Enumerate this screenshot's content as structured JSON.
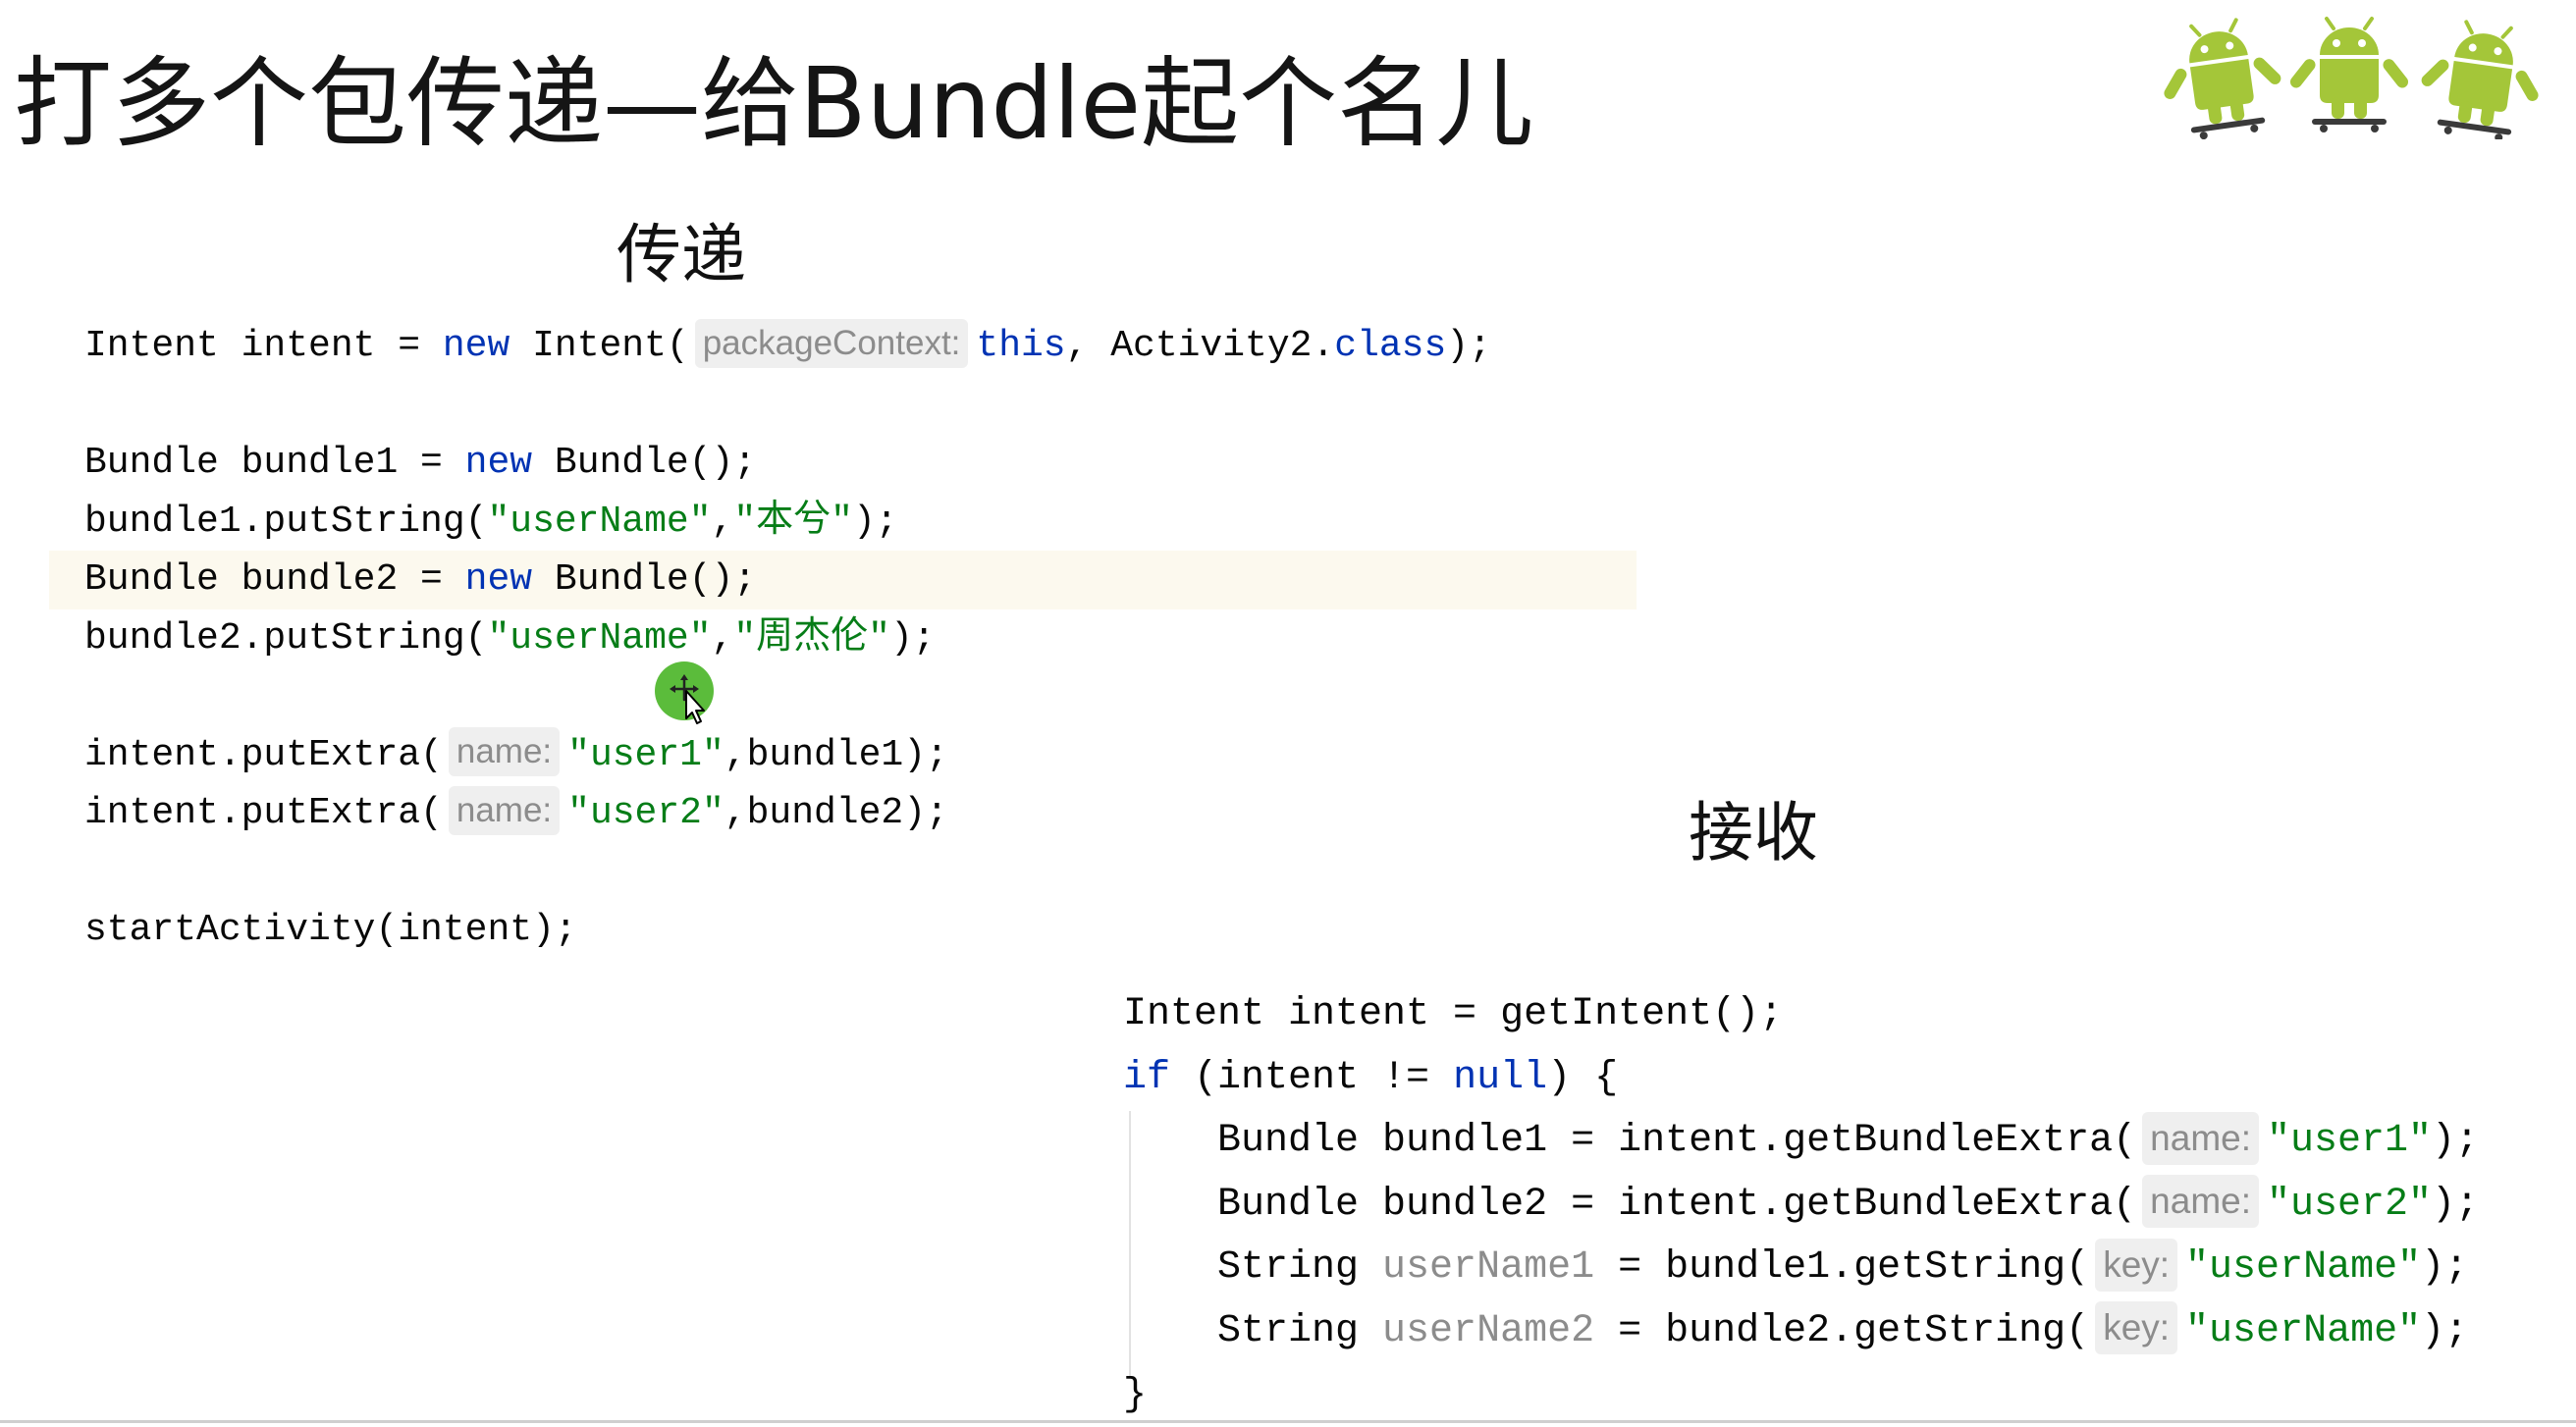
{
  "title": "打多个包传递—给Bundle起个名儿",
  "colors": {
    "text": "#080808",
    "keyword": "#0033b3",
    "string": "#067d17",
    "hint_text": "#8c8c8c",
    "hint_background": "#efefef",
    "unused_variable": "#8c8c8c",
    "current_line": "#fcf9ee",
    "android_green": "#a4c639",
    "cursor_ring": "#52b830"
  },
  "icons": {
    "logo": "android-skateboard-robots-icon",
    "cursor": "move-cursor-icon"
  },
  "send": {
    "heading": "传递",
    "current_line": 4,
    "lines": [
      [
        {
          "plain": "Intent intent = "
        },
        {
          "keyword": "new"
        },
        {
          "plain": " Intent("
        },
        {
          "hint": "packageContext:"
        },
        {
          "keyword": "this"
        },
        {
          "plain": ", Activity2."
        },
        {
          "keyword": "class"
        },
        {
          "plain": ");"
        }
      ],
      [],
      [
        {
          "plain": "Bundle bundle1 = "
        },
        {
          "keyword": "new"
        },
        {
          "plain": " Bundle();"
        }
      ],
      [
        {
          "plain": "bundle1.putString("
        },
        {
          "string": "\"userName\""
        },
        {
          "plain": ","
        },
        {
          "string": "\"本兮\""
        },
        {
          "plain": ");"
        }
      ],
      [
        {
          "plain": "Bundle bundle2 = "
        },
        {
          "keyword": "new"
        },
        {
          "plain": " Bundle();"
        }
      ],
      [
        {
          "plain": "bundle2.putString("
        },
        {
          "string": "\"userName\""
        },
        {
          "plain": ","
        },
        {
          "string": "\"周杰伦\""
        },
        {
          "plain": ");"
        }
      ],
      [],
      [
        {
          "plain": "intent.putExtra("
        },
        {
          "hint": "name:"
        },
        {
          "string": "\"user1\""
        },
        {
          "plain": ",bundle1);"
        }
      ],
      [
        {
          "plain": "intent.putExtra("
        },
        {
          "hint": "name:"
        },
        {
          "string": "\"user2\""
        },
        {
          "plain": ",bundle2);"
        }
      ],
      [],
      [
        {
          "plain": "startActivity(intent);"
        }
      ]
    ]
  },
  "receive": {
    "heading": "接收",
    "lines": [
      [
        {
          "plain": "Intent intent = getIntent();"
        }
      ],
      [
        {
          "keyword": "if"
        },
        {
          "plain": " (intent != "
        },
        {
          "keyword": "null"
        },
        {
          "plain": ") {"
        }
      ],
      [
        {
          "plain": "    Bundle bundle1 = intent.getBundleExtra("
        },
        {
          "hint": "name:"
        },
        {
          "string": "\"user1\""
        },
        {
          "plain": ");"
        }
      ],
      [
        {
          "plain": "    Bundle bundle2 = intent.getBundleExtra("
        },
        {
          "hint": "name:"
        },
        {
          "string": "\"user2\""
        },
        {
          "plain": ");"
        }
      ],
      [
        {
          "plain": "    String "
        },
        {
          "unused": "userName1"
        },
        {
          "plain": " = bundle1.getString("
        },
        {
          "hint": "key:"
        },
        {
          "string": "\"userName\""
        },
        {
          "plain": ");"
        }
      ],
      [
        {
          "plain": "    String "
        },
        {
          "unused": "userName2"
        },
        {
          "plain": " = bundle2.getString("
        },
        {
          "hint": "key:"
        },
        {
          "string": "\"userName\""
        },
        {
          "plain": ");"
        }
      ],
      [
        {
          "plain": "}"
        }
      ]
    ]
  }
}
